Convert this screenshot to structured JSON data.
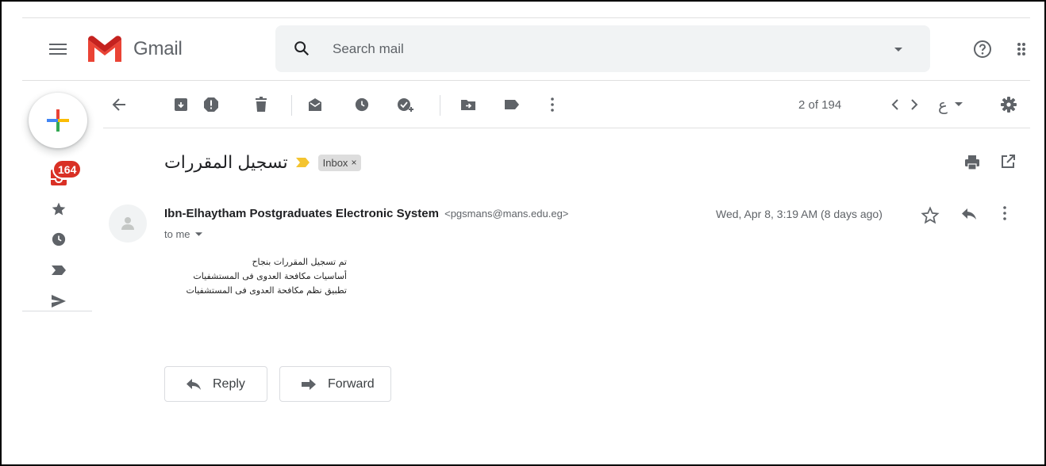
{
  "header": {
    "app_name": "Gmail",
    "search_placeholder": "Search mail"
  },
  "left_rail": {
    "inbox_count": "164"
  },
  "toolbar": {
    "pager": "2 of 194",
    "input_tool": "ع"
  },
  "message": {
    "subject": "تسجيل المقررات",
    "label_chip": "Inbox",
    "chip_close": "×",
    "sender_name": "Ibn-Elhaytham Postgraduates Electronic System",
    "sender_email": "<pgsmans@mans.edu.eg>",
    "recipient": "to me",
    "date": "Wed, Apr 8, 3:19 AM (8 days ago)",
    "body_lines": [
      "تم تسجيل المقررات بنجاح",
      "أساسيات مكافحة العدوى فى المستشفيات",
      "تطبيق نظم مكافحة العدوى فى المستشفيات"
    ]
  },
  "actions": {
    "reply_label": "Reply",
    "forward_label": "Forward"
  },
  "colors": {
    "gmail_red": "#EA4335",
    "badge_red": "#D93025",
    "importance_yellow": "#F4C430",
    "icon_gray": "#5F6368"
  }
}
